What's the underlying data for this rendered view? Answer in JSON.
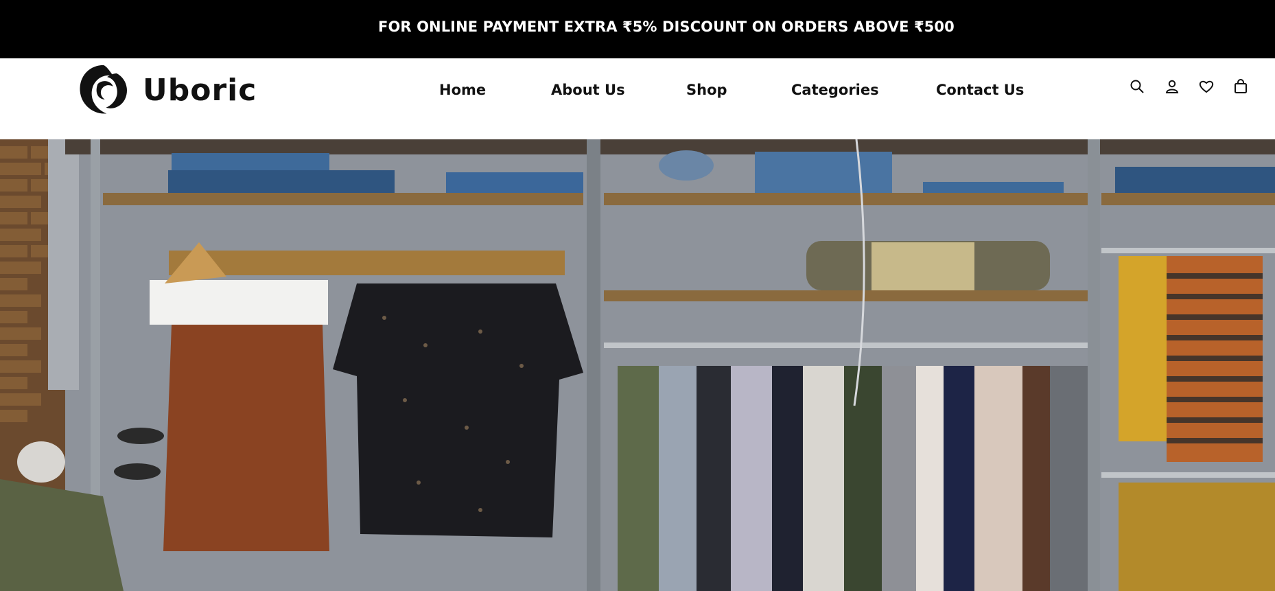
{
  "promo": {
    "text": "FOR ONLINE PAYMENT EXTRA ₹5% DISCOUNT ON ORDERS ABOVE ₹500"
  },
  "brand": {
    "name": "Uboric"
  },
  "nav": {
    "items": [
      {
        "label": "Home"
      },
      {
        "label": "About Us"
      },
      {
        "label": "Shop"
      },
      {
        "label": "Categories"
      },
      {
        "label": "Contact Us"
      }
    ]
  },
  "header_icons": [
    "search-icon",
    "user-icon",
    "heart-icon",
    "shopping-bag-icon"
  ],
  "hero": {
    "image_semantic": "clothing-store-rack-photo"
  },
  "colors": {
    "promo_bg": "#000000",
    "promo_text": "#ffffff",
    "header_bg": "#ffffff",
    "nav_text": "#111111"
  }
}
